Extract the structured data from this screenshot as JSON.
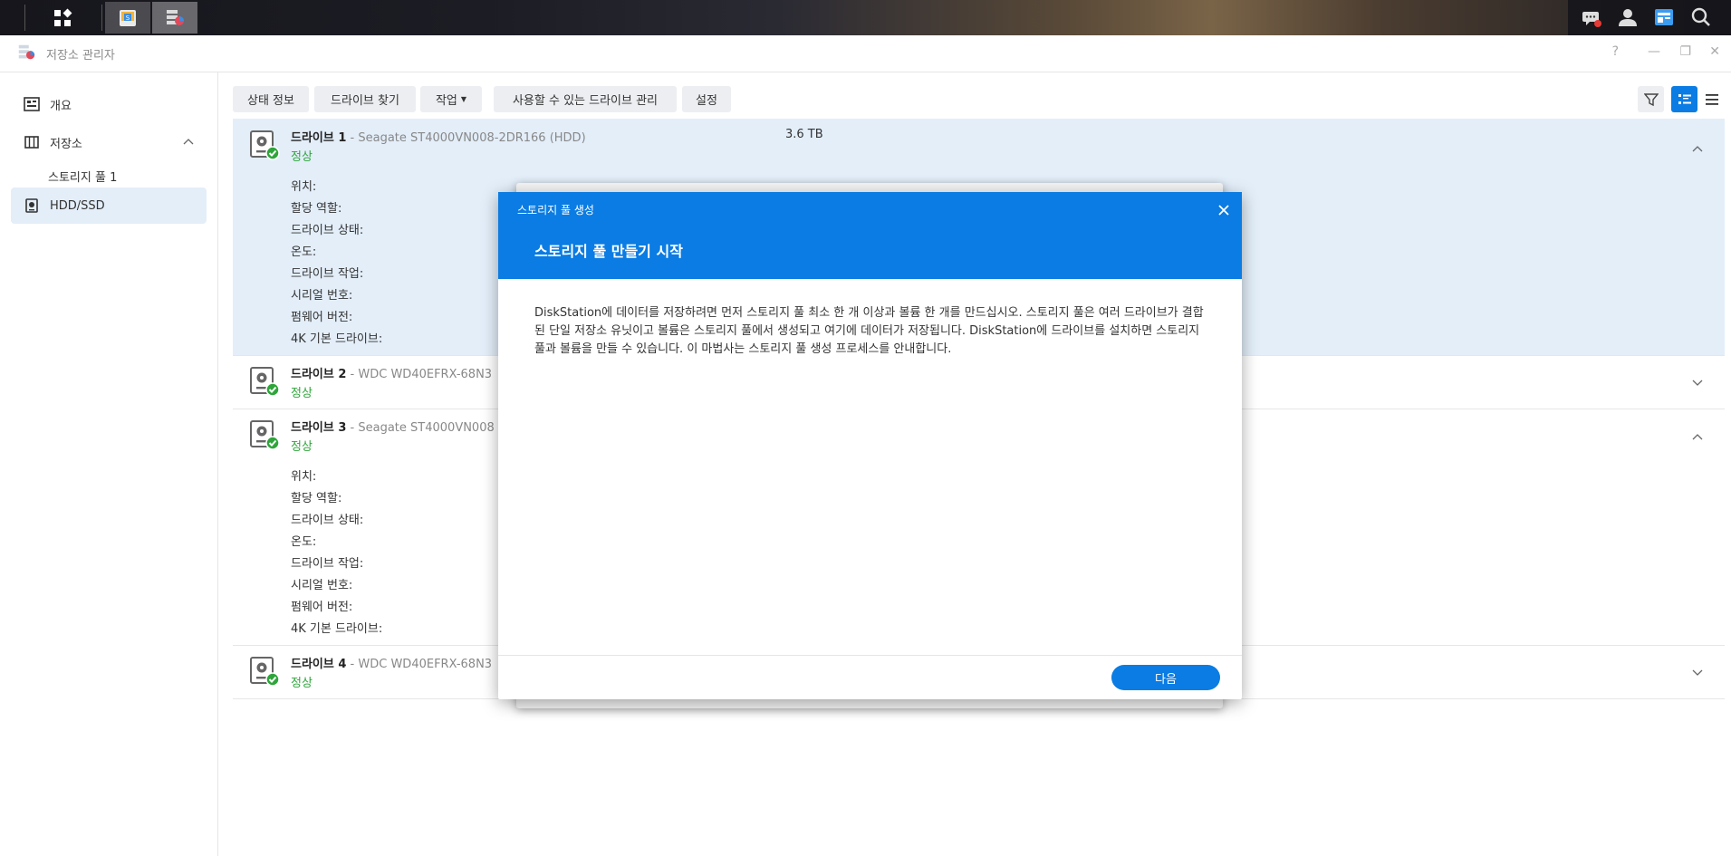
{
  "window": {
    "title": "저장소 관리자",
    "controls": [
      "?",
      "—",
      "❐",
      "✕"
    ]
  },
  "sidebar": {
    "items": [
      {
        "label": "개요",
        "icon": "overview-icon"
      },
      {
        "label": "저장소",
        "icon": "storage-icon"
      },
      {
        "label": "HDD/SSD",
        "icon": "drive-icon"
      }
    ],
    "sub_items": [
      {
        "label": "스토리지 풀 1"
      }
    ]
  },
  "toolbar": {
    "status_info": "상태 정보",
    "find_drive": "드라이브 찾기",
    "action": "작업",
    "manage_available": "사용할 수 있는 드라이브 관리",
    "settings": "설정"
  },
  "drives": [
    {
      "name": "드라이브 1",
      "model": " - Seagate ST4000VN008-2DR166 (HDD)",
      "status": "정상",
      "capacity": "3.6 TB",
      "expanded": true
    },
    {
      "name": "드라이브 2",
      "model": " - WDC WD40EFRX-68N3",
      "status": "정상",
      "expanded": false
    },
    {
      "name": "드라이브 3",
      "model": " - Seagate ST4000VN008",
      "status": "정상",
      "expanded": true
    },
    {
      "name": "드라이브 4",
      "model": " - WDC WD40EFRX-68N3",
      "status": "정상",
      "expanded": false
    }
  ],
  "detail_labels": [
    "위치:",
    "할당 역할:",
    "드라이브 상태:",
    "온도:",
    "드라이브 작업:",
    "시리얼 번호:",
    "펌웨어 버전:",
    "4K 기본 드라이브:"
  ],
  "modal": {
    "subtitle": "스토리지 풀 생성",
    "title": "스토리지 풀 만들기 시작",
    "body": "DiskStation에 데이터를 저장하려면 먼저 스토리지 풀 최소 한 개 이상과 볼륨 한 개를 만드십시오. 스토리지 풀은 여러 드라이브가 결합된 단일 저장소 유닛이고 볼륨은 스토리지 풀에서 생성되고 여기에 데이터가 저장됩니다. DiskStation에 드라이브를 설치하면 스토리지 풀과 볼륨을 만들 수 있습니다. 이 마법사는 스토리지 풀 생성 프로세스를 안내합니다.",
    "next_label": "다음"
  },
  "colors": {
    "accent": "#0a7ce3",
    "ok": "#2ea53a",
    "selected_row": "#e3eef9"
  }
}
